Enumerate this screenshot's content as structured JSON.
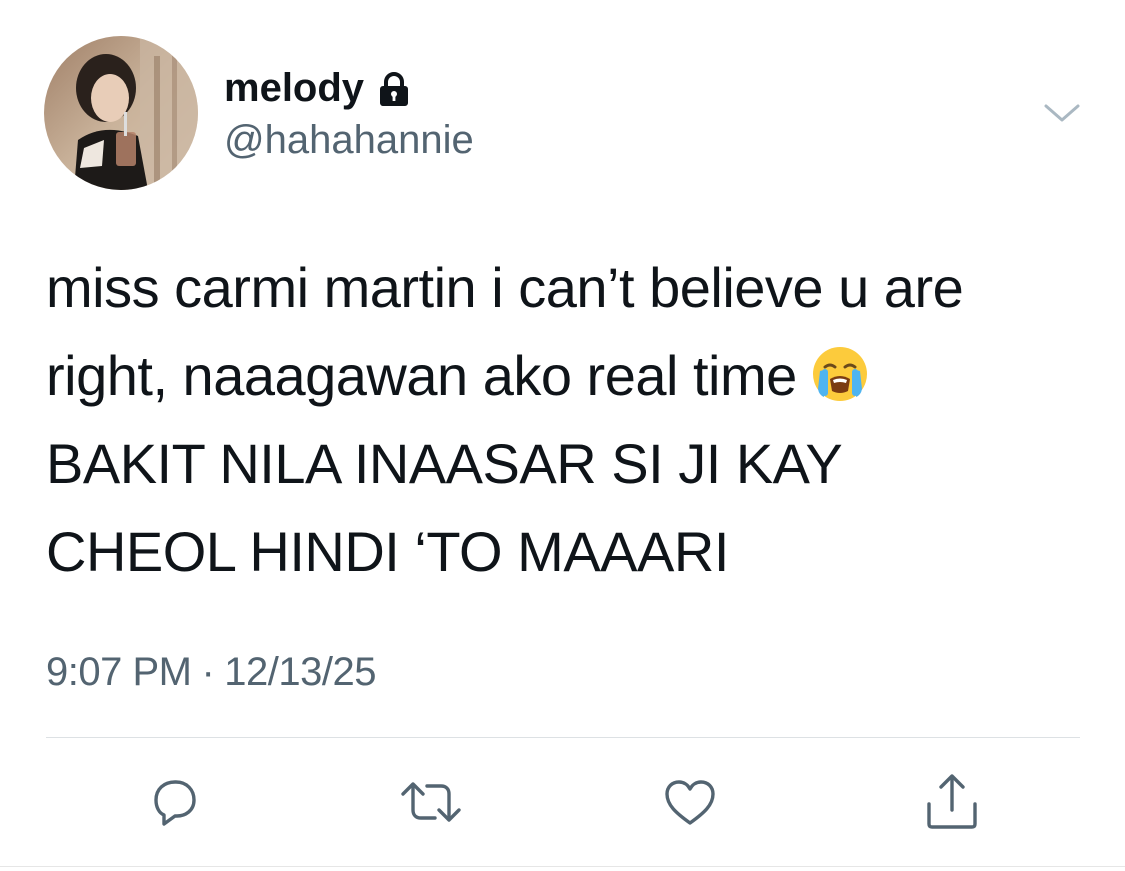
{
  "author": {
    "display_name": "melody",
    "handle": "@hahahannie",
    "protected_icon": "lock-icon",
    "avatar": "profile-photo"
  },
  "tweet": {
    "lines": [
      "miss carmi martin i can’t believe u are",
      "right, naaagawan ako real time",
      "BAKIT NILA INAASAR SI JI KAY",
      "CHEOL HINDI ‘TO MAAARI"
    ],
    "emoji": "loudly-crying-face"
  },
  "meta": {
    "time": "9:07 PM",
    "separator": "·",
    "date": "12/13/25"
  },
  "actions": [
    "reply-icon",
    "retweet-icon",
    "like-icon",
    "share-icon"
  ],
  "colors": {
    "text": "#0f1419",
    "secondary": "#536471",
    "divider": "#dde1e4",
    "icon": "#536471"
  }
}
